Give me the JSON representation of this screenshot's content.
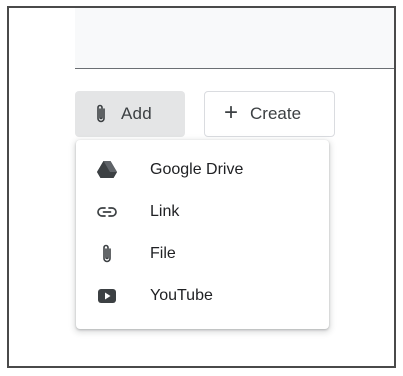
{
  "toolbar": {
    "add_label": "Add",
    "create_label": "Create"
  },
  "menu": {
    "items": [
      {
        "label": "Google Drive",
        "icon": "google-drive-icon"
      },
      {
        "label": "Link",
        "icon": "link-icon"
      },
      {
        "label": "File",
        "icon": "paperclip-icon"
      },
      {
        "label": "YouTube",
        "icon": "youtube-icon"
      }
    ]
  },
  "colors": {
    "text": "#3c4043",
    "menu_text": "#202124",
    "add_button_bg": "#e4e5e6",
    "border": "#dadce0"
  }
}
